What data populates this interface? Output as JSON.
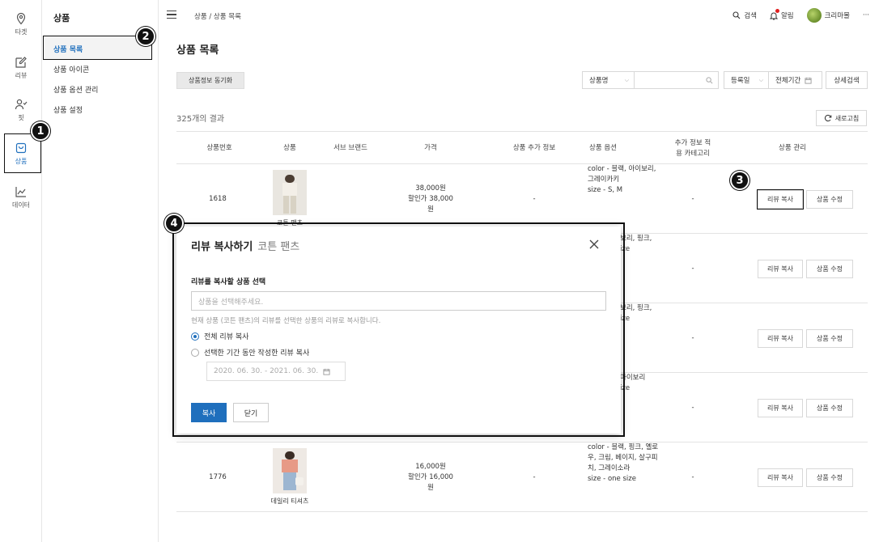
{
  "rail": [
    {
      "icon": "location-pin-icon",
      "label": "타겟"
    },
    {
      "icon": "edit-icon",
      "label": "리뷰"
    },
    {
      "icon": "user-check-icon",
      "label": "핏"
    },
    {
      "icon": "shopping-bag-icon",
      "label": "상품"
    },
    {
      "icon": "chart-line-icon",
      "label": "데이터"
    }
  ],
  "subnav": {
    "title": "상품",
    "items": [
      "상품 목록",
      "상품 아이콘",
      "상품 옵션 관리",
      "상품 설정"
    ]
  },
  "header": {
    "breadcrumb": "상품 / 상품 목록",
    "search": "검색",
    "alarm": "알림",
    "user": "크리마몰",
    "more": "···"
  },
  "page": {
    "title": "상품 목록",
    "sync_button": "상품정보 동기화",
    "search_field": "상품명",
    "date_field": "등록일",
    "date_range": "전체기간",
    "advanced_search": "상세검색",
    "results": "325개의 결과",
    "refresh": "새로고침"
  },
  "table": {
    "headers": [
      "상품번호",
      "상품",
      "서브 브랜드",
      "가격",
      "상품 추가 정보",
      "상품 옵션",
      "추가 정보 적\n용 카테고리",
      "상품 관리"
    ],
    "copy_button": "리뷰 복사",
    "edit_button": "상품 수정",
    "rows": [
      {
        "id": "1618",
        "name": "코튼 팬츠",
        "price": "38,000원",
        "discount": "할인가 38,000원",
        "extra": "-",
        "options": [
          "color - 블랙, 아이보리,",
          "그레이카키",
          "size - S, M"
        ],
        "category": "-"
      },
      {
        "id": "",
        "name": "",
        "price": "",
        "discount": "",
        "extra": "",
        "options": [
          "보리, 핑크,",
          "",
          "ize"
        ],
        "category": "-"
      },
      {
        "id": "",
        "name": "",
        "price": "",
        "discount": "",
        "extra": "",
        "options": [
          "보리, 핑크,",
          "",
          "ize"
        ],
        "category": "-"
      },
      {
        "id": "",
        "name": "",
        "price": "",
        "discount": "",
        "extra": "",
        "options": [
          "아이보리",
          "",
          "ize"
        ],
        "category": "-"
      },
      {
        "id": "1776",
        "name": "데일리 티셔츠",
        "price": "16,000원",
        "discount": "할인가 16,000원",
        "extra": "-",
        "options": [
          "color - 블랙, 핑크, 옐로",
          "우, 크림, 베이지, 살구피",
          "치, 그레이소라",
          "size - one size"
        ],
        "category": "-"
      }
    ]
  },
  "modal": {
    "title": "리뷰 복사하기",
    "subtitle": "코튼 팬츠",
    "label": "리뷰를 복사할 상품 선택",
    "placeholder": "상품을 선택해주세요.",
    "help": "현재 상품 (코튼 팬츠)의 리뷰를 선택한 상품의 리뷰로 복사합니다.",
    "option_all": "전체 리뷰 복사",
    "option_period": "선택한 기간 동안 작성한 리뷰 복사",
    "range": "2020. 06. 30. - 2021. 06. 30.",
    "ok": "복사",
    "cancel": "닫기"
  },
  "steps": [
    "1",
    "2",
    "3",
    "4"
  ],
  "colors": {
    "accent": "#1f6fbd",
    "alarm_dot": "#e02020",
    "marker": "#111111"
  }
}
